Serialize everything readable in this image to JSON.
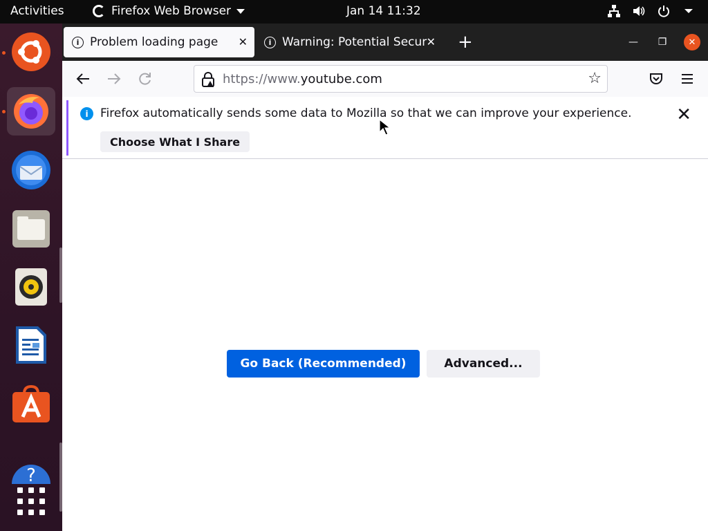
{
  "topbar": {
    "activities": "Activities",
    "app_name": "Firefox Web Browser",
    "clock": "Jan 14  11:32"
  },
  "tabs": [
    {
      "title": "Problem loading page",
      "active": true
    },
    {
      "title": "Warning: Potential Security Risk Ahead",
      "active": false
    }
  ],
  "urlbar": {
    "prefix": "https://www.",
    "domain": "youtube.com"
  },
  "notice": {
    "text": "Firefox automatically sends some data to Mozilla so that we can improve your experience.",
    "button_label": "Choose What I Share"
  },
  "page": {
    "go_back_label": "Go Back (Recommended)",
    "advanced_label": "Advanced..."
  },
  "dock": {
    "items": [
      "ubuntu-logo",
      "firefox",
      "thunderbird",
      "files",
      "rhythmbox",
      "libreoffice-writer",
      "software-center",
      "help",
      "show-applications"
    ]
  },
  "colors": {
    "accent_blue": "#0061e0",
    "ubuntu_orange": "#e95420",
    "notice_border": "#9059ff",
    "info_blue": "#0090ed"
  }
}
